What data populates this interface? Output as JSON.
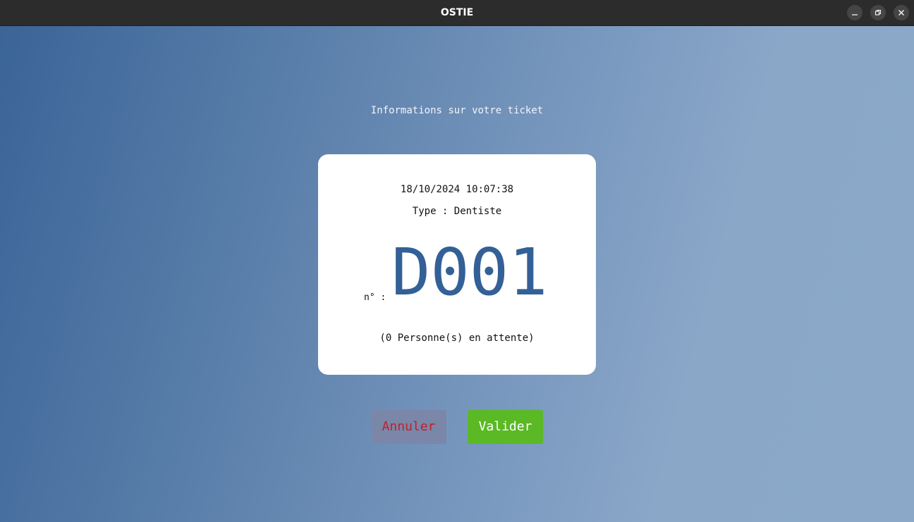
{
  "window": {
    "title": "OSTIE"
  },
  "colors": {
    "titlebar": "#2c2c2c",
    "accent_number": "#336096",
    "validate_button": "#5ab925",
    "cancel_button": "#7a87a8",
    "cancel_text": "#c21f2a"
  },
  "icons": {
    "minimize": "minimize-icon",
    "maximize": "maximize-icon",
    "close": "close-icon"
  },
  "main": {
    "heading": "Informations sur votre ticket",
    "ticket": {
      "datetime": "18/10/2024 10:07:38",
      "type": "Type : Dentiste",
      "number_prefix": "n° :",
      "number": "D001",
      "waiting": "(0 Personne(s) en attente)"
    },
    "buttons": {
      "cancel": "Annuler",
      "validate": "Valider"
    }
  }
}
